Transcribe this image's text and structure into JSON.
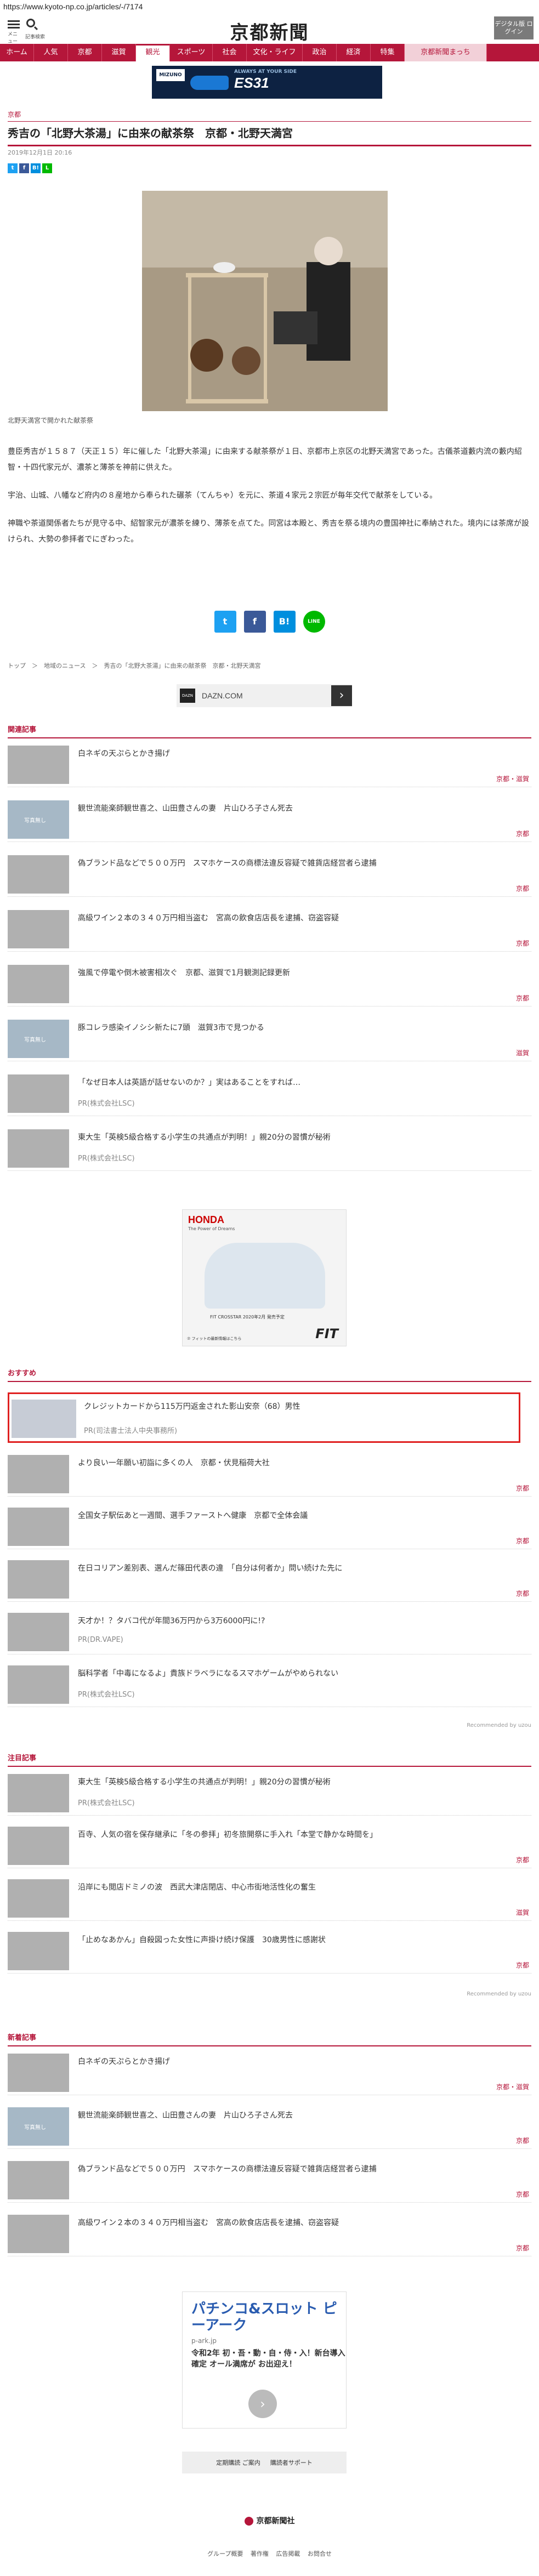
{
  "url": "https://www.kyoto-np.co.jp/articles/-/7174",
  "header": {
    "menu_label": "メニュー",
    "search_label": "記事検索",
    "logo": "京都新聞",
    "digital_button": "デジタル版 ログイン"
  },
  "nav": [
    "ホーム",
    "人気",
    "京都",
    "滋賀",
    "観光",
    "スポーツ",
    "社会",
    "文化・ライフ",
    "政治",
    "経済",
    "特集",
    "京都新聞まっち"
  ],
  "nav_active": "観光",
  "ad_top": {
    "brand": "MIZUNO",
    "sub": "ALWAYS AT YOUR SIDE",
    "model": "ES31"
  },
  "article": {
    "category": "京都",
    "title": "秀吉の「北野大茶湯」に由来の献茶祭　京都・北野天満宮",
    "date": "2019年12月1日 20:16",
    "sns_small": [
      "t",
      "f",
      "B!",
      "L"
    ],
    "photo_caption": "北野天満宮で開かれた献茶祭",
    "paragraphs": [
      "豊臣秀吉が１５８７（天正１５）年に催した「北野大茶湯」に由来する献茶祭が１日、京都市上京区の北野天満宮であった。古儀茶道藪内流の藪内紹智・十四代家元が、濃茶と薄茶を神前に供えた。",
      "宇治、山城、八幡など府内の８産地から奉られた碾茶（てんちゃ）を元に、茶道４家元２宗匠が毎年交代で献茶をしている。",
      "神職や茶道関係者たちが見守る中、紹智家元が濃茶を練り、薄茶を点てた。同宮は本殿と、秀吉を祭る境内の豊国神社に奉納された。境内には茶席が設けられ、大勢の参拝者でにぎわった。"
    ],
    "share": [
      "t",
      "f",
      "B!",
      "LINE"
    ],
    "breadcrumb": "トップ　＞　地域のニュース　＞　秀吉の「北野大茶湯」に由来の献茶祭　京都・北野天満宮"
  },
  "ad_dazn": {
    "text": "DAZN.COM",
    "logo": "DAZN"
  },
  "related": {
    "heading": "関連記事",
    "items": [
      {
        "title": "白ネギの天ぷらとかき揚げ",
        "cat": "京都・滋賀",
        "photo": true
      },
      {
        "title": "観世流能楽師観世喜之、山田豊さんの妻　片山ひろ子さん死去",
        "cat": "京都",
        "photo": false
      },
      {
        "title": "偽ブランド品などで５００万円　スマホケースの商標法違反容疑で雑貨店経営者ら逮捕",
        "cat": "京都",
        "photo": true
      },
      {
        "title": "高級ワイン２本の３４０万円相当盗む　宮高の飲食店店長を逮捕、窃盗容疑",
        "cat": "京都",
        "photo": true
      },
      {
        "title": "強風で停電や倒木被害相次ぐ　京都、滋賀で1月観測記録更新",
        "cat": "京都",
        "photo": true
      },
      {
        "title": "豚コレラ感染イノシシ新たに7頭　滋賀3市で見つかる",
        "cat": "滋賀",
        "photo": false
      },
      {
        "title": "「なぜ日本人は英語が話せないのか？」実はあることをすれば…",
        "pr": "PR(株式会社LSC)",
        "photo": true
      },
      {
        "title": "東大生「英検5級合格する小学生の共通点が判明！」親20分の習慣が秘術",
        "pr": "PR(株式会社LSC)",
        "photo": true
      }
    ]
  },
  "ad_honda": {
    "brand": "HONDA",
    "tagline": "The Power of Dreams",
    "model_text": "FIT CROSSTAR 2020年2月 発売予定",
    "name": "FIT",
    "note": "⑦ フィットの最新情報はこちら"
  },
  "recommend": {
    "heading": "おすすめ",
    "highlight": {
      "title": "クレジットカードから115万円返金された影山安奈（68）男性",
      "pr": "PR(司法書士法人中央事務所)"
    },
    "items": [
      {
        "title": "より良い一年願い初詣に多くの人　京都・伏見稲荷大社",
        "cat": "京都"
      },
      {
        "title": "全国女子駅伝あと一週間、選手ファーストへ健康　京都で全体会議",
        "cat": "京都"
      },
      {
        "title": "在日コリアン差別表、選んだ篠田代表の違　「自分は何者か」問い続けた先に",
        "cat": "京都"
      },
      {
        "title": "天才か！？タバコ代が年間36万円から3万6000円に!?",
        "pr": "PR(DR.VAPE)"
      },
      {
        "title": "脳科学者「中毒になるよ」貴族ドラベラになるスマホゲームがやめられない",
        "pr": "PR(株式会社LSC)"
      }
    ],
    "credit": "Recommended by uzou"
  },
  "attention": {
    "heading": "注目記事",
    "items": [
      {
        "title": "東大生「英検5級合格する小学生の共通点が判明！」親20分の習慣が秘術",
        "pr": "PR(株式会社LSC)"
      },
      {
        "title": "百寺、人気の宿を保存継承に「冬の参拝」初冬旅開祭に手入れ「本堂で静かな時間を」",
        "cat": "京都"
      },
      {
        "title": "沿岸にも閲店ドミノの波　西武大津店閉店、中心市街地活性化の奮生",
        "cat": "滋賀"
      },
      {
        "title": "「止めなあかん」自殺図った女性に声掛け続け保護　30歳男性に感謝状",
        "cat": "京都"
      }
    ],
    "credit": "Recommended by uzou"
  },
  "latest": {
    "heading": "新着記事",
    "items": [
      {
        "title": "白ネギの天ぷらとかき揚げ",
        "cat": "京都・滋賀",
        "photo": true
      },
      {
        "title": "観世流能楽師観世喜之、山田豊さんの妻　片山ひろ子さん死去",
        "cat": "京都",
        "photo": false
      },
      {
        "title": "偽ブランド品などで５００万円　スマホケースの商標法違反容疑で雑貨店経営者ら逮捕",
        "cat": "京都",
        "photo": true
      },
      {
        "title": "高級ワイン２本の３４０万円相当盗む　宮高の飲食店店長を逮捕、窃盗容疑",
        "cat": "京都",
        "photo": true
      }
    ]
  },
  "ad_pachi": {
    "title": "パチンコ&スロット ピーアーク",
    "domain": "p-ark.jp",
    "body": "令和2年 初・吾・動・自・侍・入！新台導入確定 オール満席が お出迎え！",
    "button": "›"
  },
  "footer": {
    "links": [
      "定期購読 ご案内",
      "購読者サポート"
    ],
    "company": "京都新聞社",
    "nav": "グループ概要 著作権 広告掲載 お問合せ"
  }
}
